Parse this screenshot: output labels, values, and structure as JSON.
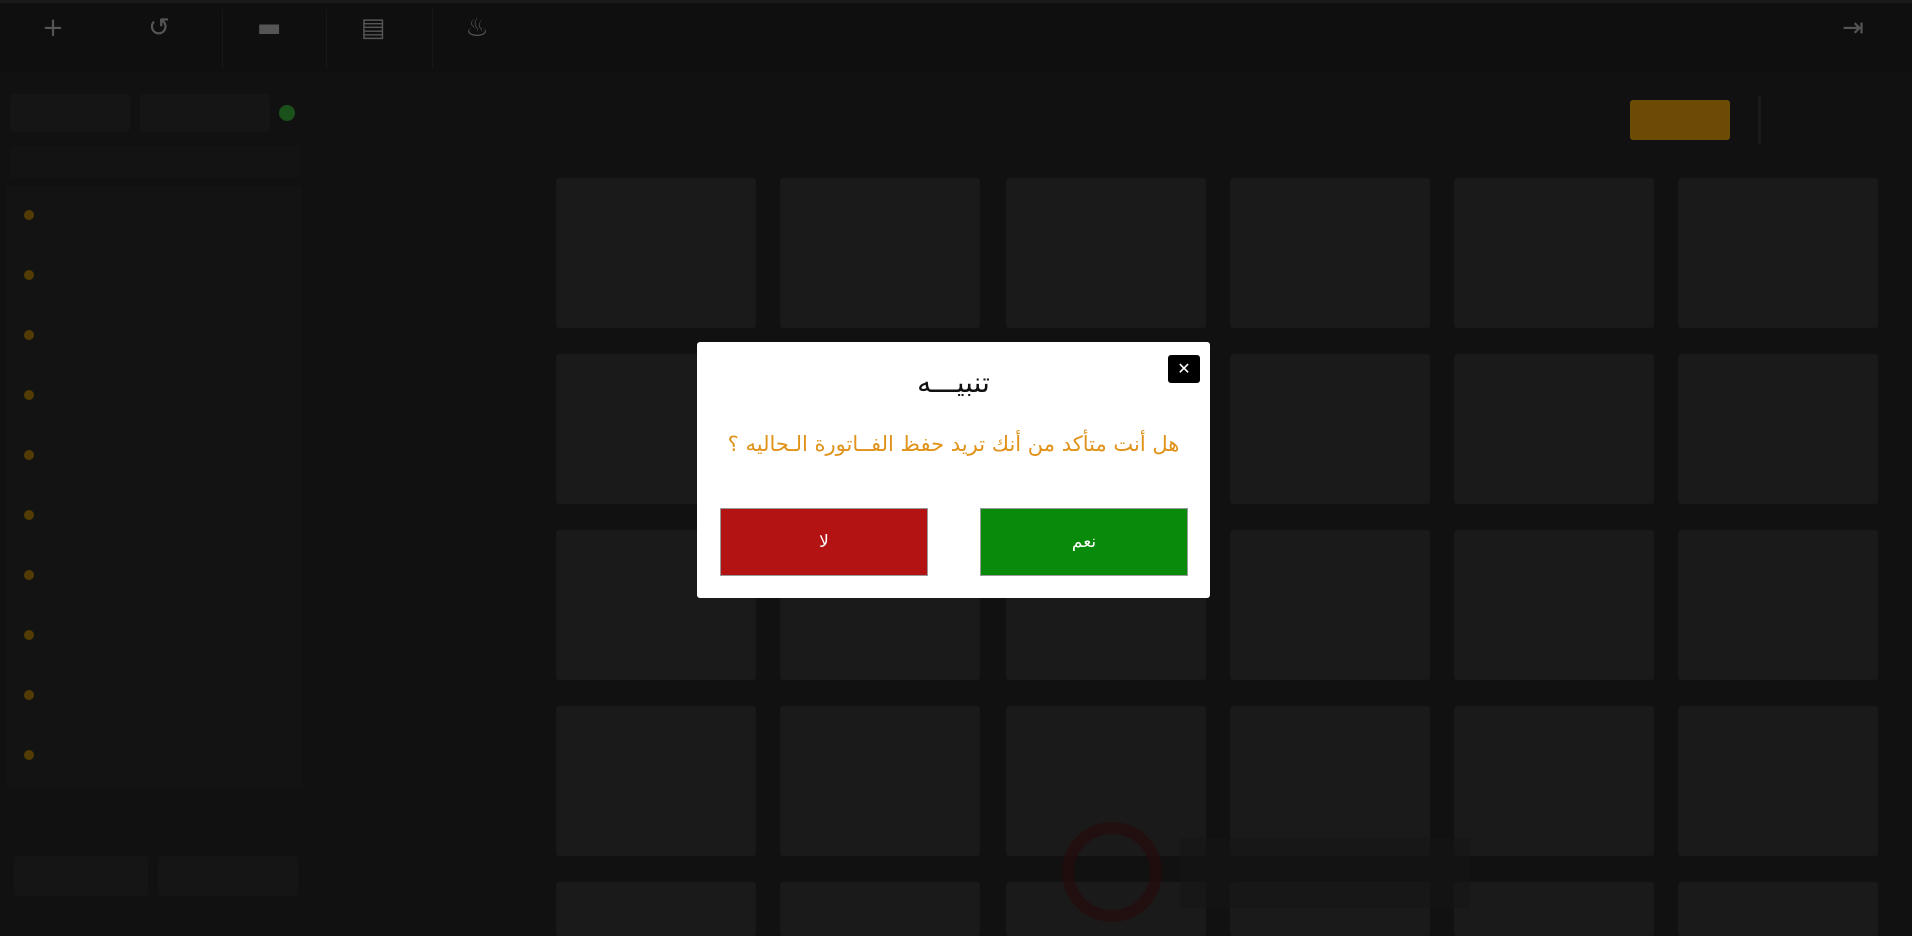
{
  "modal": {
    "title": "تنبيـــه",
    "message": "هل أنت متأكد من أنك تريد حفظ الفــاتورة الـحاليه ؟",
    "yes_label": "نعم",
    "no_label": "لا",
    "close_glyph": "✕"
  },
  "colors": {
    "yes_button": "#0a8a0a",
    "no_button": "#b31313",
    "message_text": "#e0921a",
    "active_filter": "#f0a80a"
  }
}
